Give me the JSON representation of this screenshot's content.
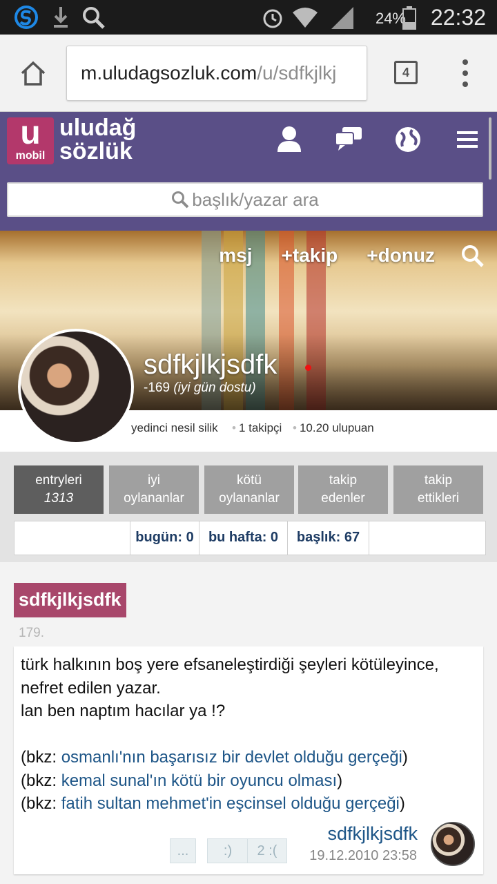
{
  "status_bar": {
    "battery": "24%",
    "time": "22:32"
  },
  "browser": {
    "url_host": "m.uludagsozluk.com",
    "url_path": "/u/sdfkjlkj",
    "tab_count": "4"
  },
  "header": {
    "logo_letter": "u",
    "logo_sub": "mobil",
    "logo_line1": "uludağ",
    "logo_line2": "sözlük",
    "search_placeholder": "başlık/yazar ara"
  },
  "cover": {
    "actions": [
      "msj",
      "+takip",
      "+donuz"
    ],
    "username": "sdfkjlkjsdfk",
    "score": "-169",
    "score_title": "(iyi gün dostu)"
  },
  "info": {
    "generation": "yedinci nesil silik",
    "followers": "1 takipçi",
    "points": "10.20 ulupuan"
  },
  "tabs": [
    {
      "label": "entryleri",
      "sub": "1313"
    },
    {
      "label": "iyi",
      "sub": "oylananlar"
    },
    {
      "label": "kötü",
      "sub": "oylananlar"
    },
    {
      "label": "takip",
      "sub": "edenler"
    },
    {
      "label": "takip",
      "sub": "ettikleri"
    }
  ],
  "stats": {
    "today": "bugün: 0",
    "week": "bu hafta: 0",
    "topics": "başlık: 67"
  },
  "entry": {
    "topic": "sdfkjlkjsdfk",
    "number": "179.",
    "line1": "türk halkının boş yere efsaneleştirdiği şeyleri kötüleyince, nefret edilen yazar.",
    "line2": "lan ben naptım hacılar ya !?",
    "bkz_prefix": "(bkz: ",
    "bkz_suffix": ")",
    "bkz": [
      "osmanlı'nın başarısız bir devlet olduğu gerçeği",
      "kemal sunal'ın kötü bir oyuncu olması",
      "fatih sultan mehmet'in eşcinsel olduğu gerçeği"
    ],
    "votes": {
      "more": "...",
      "smile": ":)",
      "frown": "2 :("
    },
    "author": "sdfkjlkjsdfk",
    "date": "19.12.2010 23:58"
  }
}
